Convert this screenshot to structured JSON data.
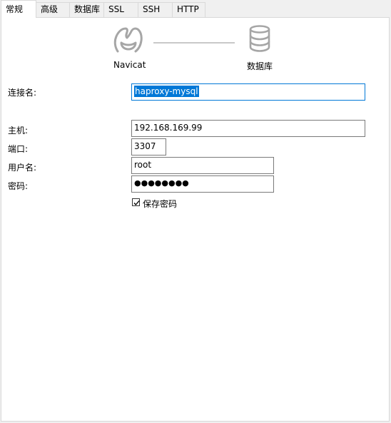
{
  "tabs": [
    "常规",
    "高级",
    "数据库",
    "SSL",
    "SSH",
    "HTTP"
  ],
  "diagram": {
    "left_label": "Navicat",
    "right_label": "数据库"
  },
  "form": {
    "connection_name_label": "连接名:",
    "connection_name_value": "haproxy-mysql",
    "host_label": "主机:",
    "host_value": "192.168.169.99",
    "port_label": "端口:",
    "port_value": "3307",
    "username_label": "用户名:",
    "username_value": "root",
    "password_label": "密码:",
    "password_value": "●●●●●●●●",
    "save_password_label": "保存密码",
    "save_password_checked": true
  }
}
